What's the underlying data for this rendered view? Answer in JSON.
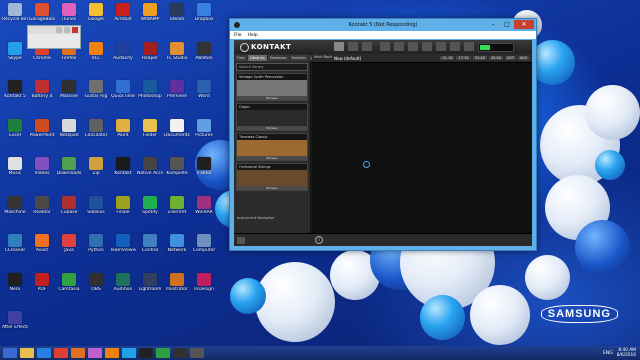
{
  "desktop": {
    "brand": "SAMSUNG",
    "icons": [
      {
        "label": "Recycle Bin",
        "color": "#9fb8d8"
      },
      {
        "label": "GarageBand",
        "color": "#e05030"
      },
      {
        "label": "iTunes",
        "color": "#e060c0"
      },
      {
        "label": "Google",
        "color": "#f2c030"
      },
      {
        "label": "Acrobat",
        "color": "#c82020"
      },
      {
        "label": "WINAMP",
        "color": "#f0a020"
      },
      {
        "label": "Steam",
        "color": "#2a3a5a"
      },
      {
        "label": "Dropbox",
        "color": "#3a80e0"
      },
      {
        "label": "Skype",
        "color": "#22a0e8"
      },
      {
        "label": "Chrome",
        "color": "#e04030"
      },
      {
        "label": "Firefox",
        "color": "#e07020"
      },
      {
        "label": "VLC",
        "color": "#f08010"
      },
      {
        "label": "Audacity",
        "color": "#2040a0"
      },
      {
        "label": "Reaper",
        "color": "#a02020"
      },
      {
        "label": "FL Studio",
        "color": "#e09030"
      },
      {
        "label": "Ableton",
        "color": "#333333"
      },
      {
        "label": "Kontakt 5",
        "color": "#222222"
      },
      {
        "label": "Battery 4",
        "color": "#c03030"
      },
      {
        "label": "Massive",
        "color": "#303030"
      },
      {
        "label": "Guitar Rig",
        "color": "#707070"
      },
      {
        "label": "QuickTime",
        "color": "#3070d0"
      },
      {
        "label": "Photoshop",
        "color": "#1a5aa0"
      },
      {
        "label": "Premiere",
        "color": "#6030a0"
      },
      {
        "label": "Word",
        "color": "#2b5fb0"
      },
      {
        "label": "Excel",
        "color": "#1e7e40"
      },
      {
        "label": "PowerPoint",
        "color": "#d04a20"
      },
      {
        "label": "Notepad",
        "color": "#d8d8d8"
      },
      {
        "label": "Calculator",
        "color": "#606060"
      },
      {
        "label": "Paint",
        "color": "#e0b040"
      },
      {
        "label": "Folder",
        "color": "#e8c050"
      },
      {
        "label": "Documents",
        "color": "#f0f0f0"
      },
      {
        "label": "Pictures",
        "color": "#60a0e0"
      },
      {
        "label": "Music",
        "color": "#e0e0e0"
      },
      {
        "label": "Videos",
        "color": "#8050c0"
      },
      {
        "label": "Downloads",
        "color": "#50a050"
      },
      {
        "label": "Zip",
        "color": "#d0a040"
      },
      {
        "label": "Kontakt",
        "color": "#1a1a1a"
      },
      {
        "label": "Native Access",
        "color": "#444444"
      },
      {
        "label": "Komplete",
        "color": "#555555"
      },
      {
        "label": "Traktor",
        "color": "#202020"
      },
      {
        "label": "Maschine",
        "color": "#353535"
      },
      {
        "label": "Reaktor",
        "color": "#4a4a4a"
      },
      {
        "label": "Cubase",
        "color": "#b03030"
      },
      {
        "label": "Sibelius",
        "color": "#2050a0"
      },
      {
        "label": "Finale",
        "color": "#a0a020"
      },
      {
        "label": "Spotify",
        "color": "#20b050"
      },
      {
        "label": "uTorrent",
        "color": "#70b030"
      },
      {
        "label": "WinRAR",
        "color": "#a03080"
      },
      {
        "label": "CCleaner",
        "color": "#3080c0"
      },
      {
        "label": "Avast",
        "color": "#f07020"
      },
      {
        "label": "Java",
        "color": "#e04040"
      },
      {
        "label": "Python",
        "color": "#3070b0"
      },
      {
        "label": "TeamViewer",
        "color": "#1060c0"
      },
      {
        "label": "Control",
        "color": "#4080c0"
      },
      {
        "label": "Network",
        "color": "#4090e0"
      },
      {
        "label": "Computer",
        "color": "#7090c0"
      },
      {
        "label": "Nero",
        "color": "#202020"
      },
      {
        "label": "PDF",
        "color": "#c02020"
      },
      {
        "label": "Camtasia",
        "color": "#30a040"
      },
      {
        "label": "OBS",
        "color": "#303030"
      },
      {
        "label": "Audition",
        "color": "#207060"
      },
      {
        "label": "Lightroom",
        "color": "#304060"
      },
      {
        "label": "Illustrator",
        "color": "#d07020"
      },
      {
        "label": "InDesign",
        "color": "#c02060"
      },
      {
        "label": "After Effects",
        "color": "#4040a0"
      }
    ]
  },
  "mini_window": {
    "title": ""
  },
  "kontakt": {
    "window_title": "Kontakt 5 (Not Responding)",
    "menu": [
      "File",
      "Help"
    ],
    "logo": "KONTAKT",
    "browser_tabs": [
      "Files",
      "Libraries",
      "Database",
      "Modules",
      "Automation",
      "Monitor"
    ],
    "search_placeholder": "Search library",
    "libraries": [
      {
        "name": "Vintage Synth Percussion",
        "button": "Browse",
        "art_color": "#777777"
      },
      {
        "name": "Organ",
        "button": "Browse",
        "art_color": "#2a2a2a"
      },
      {
        "name": "Timeless Classic",
        "button": "Browse",
        "art_color": "#9a6a30"
      },
      {
        "name": "Orchestral Strings",
        "button": "Browse",
        "art_color": "#6a4a2a"
      }
    ],
    "instrument_navigator": "Instrument Navigator",
    "rack_multi_label": "Multi Rack",
    "rack_name": "New (default)",
    "rack_values": [
      "01-16",
      "17-32",
      "33-48",
      "49-64",
      "KSP",
      "AUX"
    ]
  },
  "taskbar": {
    "buttons": [
      {
        "name": "start",
        "color": "#3a6ad0"
      },
      {
        "name": "explorer",
        "color": "#e8c050"
      },
      {
        "name": "ie",
        "color": "#2a80e0"
      },
      {
        "name": "chrome",
        "color": "#e04030"
      },
      {
        "name": "firefox",
        "color": "#e07020"
      },
      {
        "name": "itunes",
        "color": "#c060d0"
      },
      {
        "name": "vlc",
        "color": "#f08010"
      },
      {
        "name": "skype",
        "color": "#22a0e8"
      },
      {
        "name": "kontakt",
        "color": "#222222"
      },
      {
        "name": "camtasia",
        "color": "#30a040"
      },
      {
        "name": "app1",
        "color": "#303030"
      },
      {
        "name": "app2",
        "color": "#555555"
      }
    ],
    "language": "ENG",
    "time": "8:40 AM",
    "date": "8/6/2016"
  }
}
